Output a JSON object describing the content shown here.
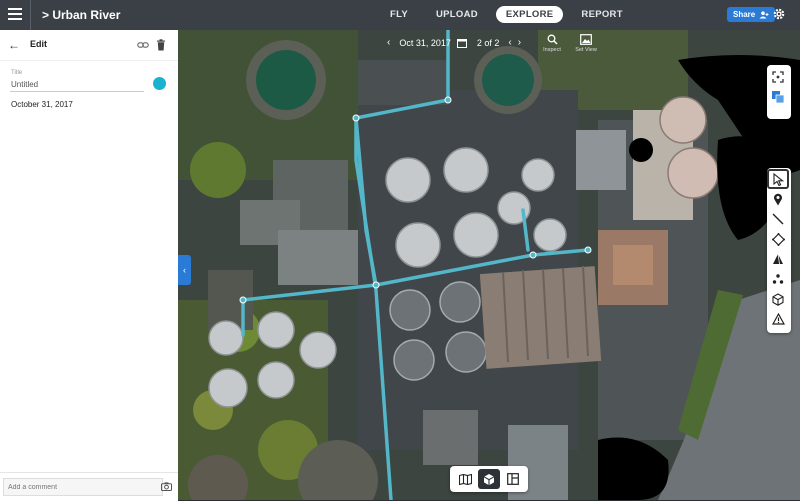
{
  "app": {
    "title": "> Urban River"
  },
  "nav": {
    "tabs": [
      "FLY",
      "UPLOAD",
      "EXPLORE",
      "REPORT"
    ],
    "active": "EXPLORE"
  },
  "header": {
    "share_label": "Share"
  },
  "panel": {
    "title": "Edit",
    "field_label": "Title",
    "title_value": "Untitled",
    "date": "October 31, 2017",
    "comment_placeholder": "Add a comment",
    "color": "#19b3cf"
  },
  "map": {
    "date": "Oct 31, 2017",
    "page": "2 of 2",
    "inspect_label": "Inspect",
    "setview_label": "Set View",
    "annotation_color": "#53b7c9"
  },
  "tools": {
    "top": [
      "expand-icon",
      "layers-icon"
    ],
    "drawing": [
      "pointer-icon",
      "location-pin-icon",
      "line-icon",
      "polygon-icon",
      "volume-icon",
      "points-icon",
      "3d-box-icon",
      "warning-triangle-icon"
    ],
    "selected": "pointer-icon"
  },
  "views": [
    "map-view-icon",
    "3d-view-icon",
    "split-view-icon"
  ],
  "selected_view": "3d-view-icon"
}
